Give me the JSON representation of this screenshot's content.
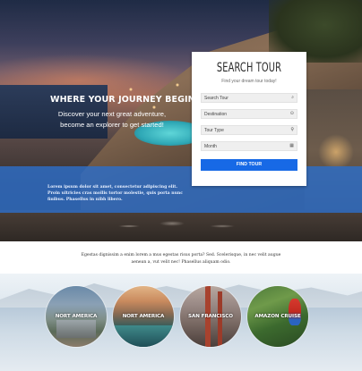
{
  "hero": {
    "headline": "WHERE YOUR JOURNEY BEGINS.",
    "subline_1": "Discover your next great adventure,",
    "subline_2": "become an explorer to get started!",
    "band_text_1": "Lorem ipsum dolor sit amet, consectetur adipiscing elit.",
    "band_text_2": "Proin ultricies cras mollis tortor molestie, quis porta nunc",
    "band_text_3": "finibus. Phasellus in nibh libero."
  },
  "search_tour": {
    "title": "SEARCH TOUR",
    "subtitle": "Find your dream tour today!",
    "fields": [
      {
        "label": "Search Tour",
        "icon": "search-icon",
        "glyph": "⌕"
      },
      {
        "label": "Destination",
        "icon": "location-icon",
        "glyph": "⊙"
      },
      {
        "label": "Tour Type",
        "icon": "tag-icon",
        "glyph": "♀"
      },
      {
        "label": "Month",
        "icon": "calendar-icon",
        "glyph": "▦"
      }
    ],
    "button_label": "FIND TOUR",
    "button_color": "#1769e6"
  },
  "middle": {
    "line_1": "Egestas dignissim a enim lorem a mus egestas risus porta? Sed. Scelerisque, in nec velit augue",
    "line_2": "aenean a, vut velit nec! Phasellus aliquam odio."
  },
  "destinations": [
    {
      "label": "NORT AMERICA"
    },
    {
      "label": "NORT AMERICA"
    },
    {
      "label": "SAN FRANCISCO"
    },
    {
      "label": "AMAZON CRUISE"
    }
  ],
  "colors": {
    "band_blue": "#2d6ec8",
    "button_blue": "#1769e6"
  }
}
